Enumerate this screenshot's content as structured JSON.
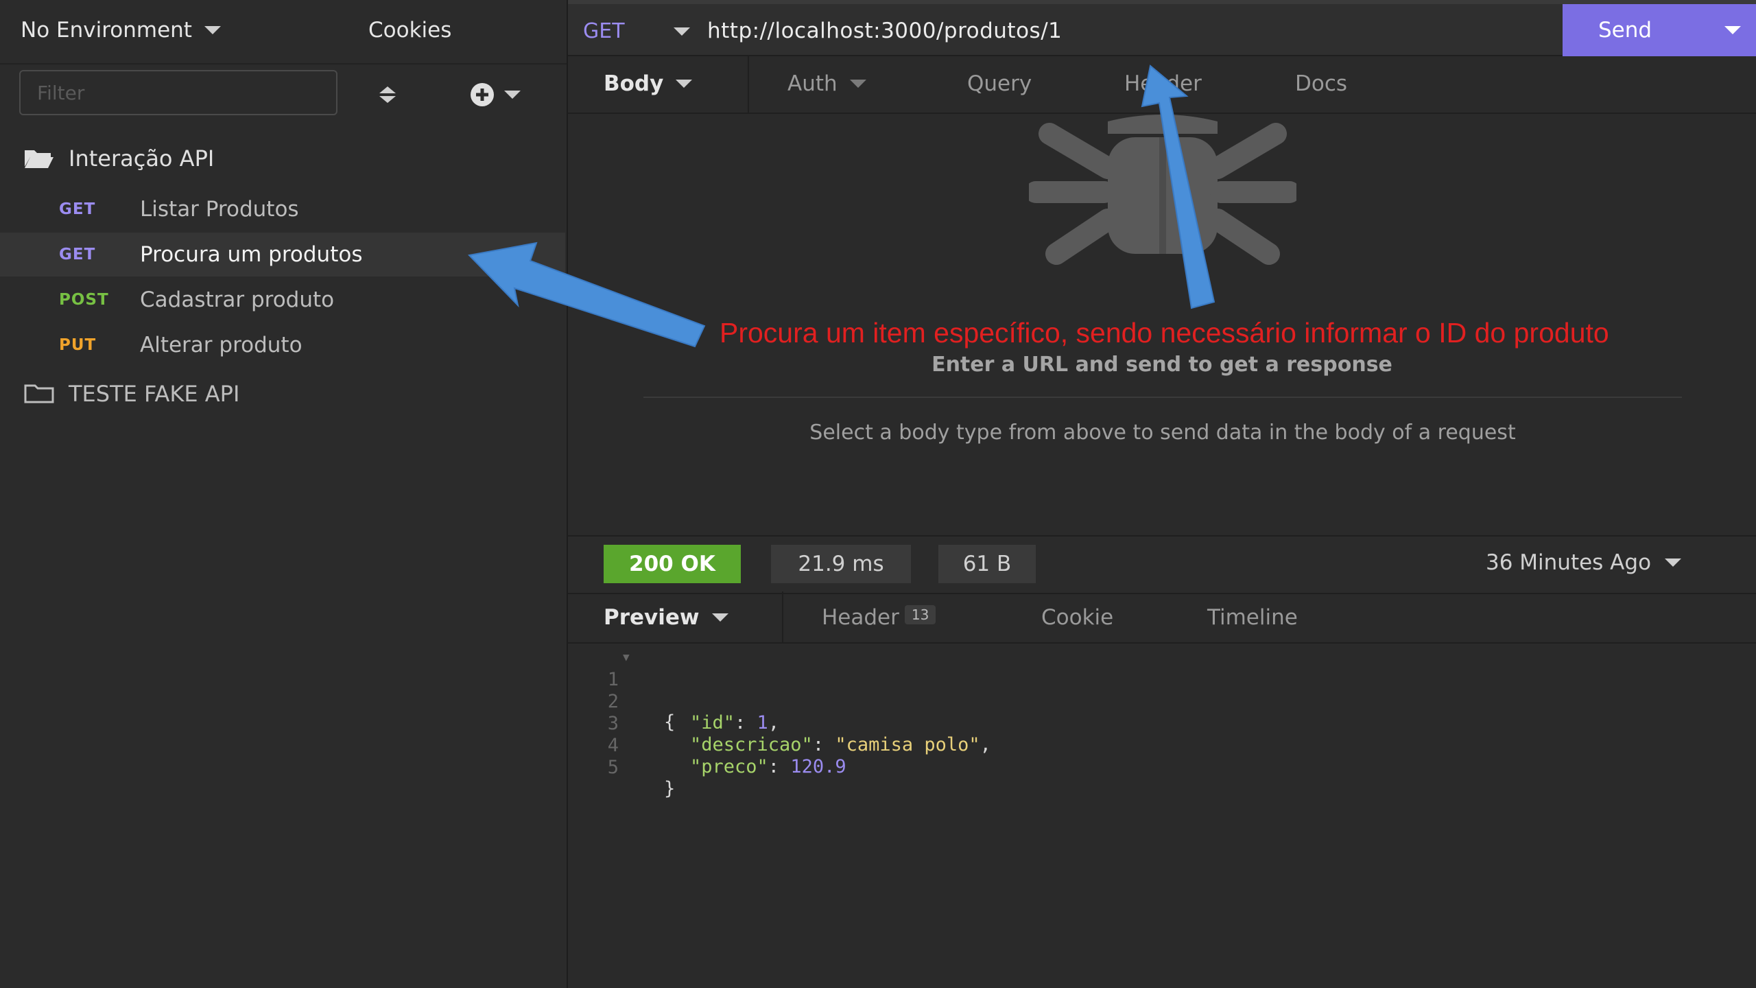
{
  "sidebar": {
    "environment": "No Environment",
    "cookies": "Cookies",
    "filter_placeholder": "Filter",
    "folders": [
      {
        "name": "Interação API",
        "requests": [
          {
            "method": "GET",
            "name": "Listar Produtos"
          },
          {
            "method": "GET",
            "name": "Procura um produtos",
            "active": true
          },
          {
            "method": "POST",
            "name": "Cadastrar produto"
          },
          {
            "method": "PUT",
            "name": "Alterar produto"
          }
        ]
      },
      {
        "name": "TESTE FAKE API",
        "requests": []
      }
    ]
  },
  "request": {
    "method": "GET",
    "url": "http://localhost:3000/produtos/1",
    "send_label": "Send",
    "tabs": [
      "Body",
      "Auth",
      "Query",
      "Header",
      "Docs"
    ],
    "empty_title": "Enter a URL and send to get a response",
    "empty_body": "Select a body type from above to send data in the body of a request"
  },
  "response": {
    "status": "200 OK",
    "time": "21.9 ms",
    "size": "61 B",
    "time_ago": "36 Minutes Ago",
    "tabs": [
      "Preview",
      "Header",
      "Cookie",
      "Timeline"
    ],
    "header_count": "13",
    "line_numbers": [
      "1",
      "2",
      "3",
      "4",
      "5"
    ],
    "json": {
      "open": "{",
      "id_key": "\"id\"",
      "id_val": "1",
      "desc_key": "\"descricao\"",
      "desc_val": "\"camisa polo\"",
      "preco_key": "\"preco\"",
      "preco_val": "120.9",
      "close": "}"
    }
  },
  "annotation": "Procura um item específico, sendo necessário informar o ID do produto",
  "colors": {
    "accent": "#7b6ee3",
    "get": "#9b8cf0",
    "post": "#77c043",
    "put": "#f0a32b",
    "status_ok": "#5aa62d",
    "annotation": "#e12020",
    "arrow": "#4a8fd9"
  }
}
